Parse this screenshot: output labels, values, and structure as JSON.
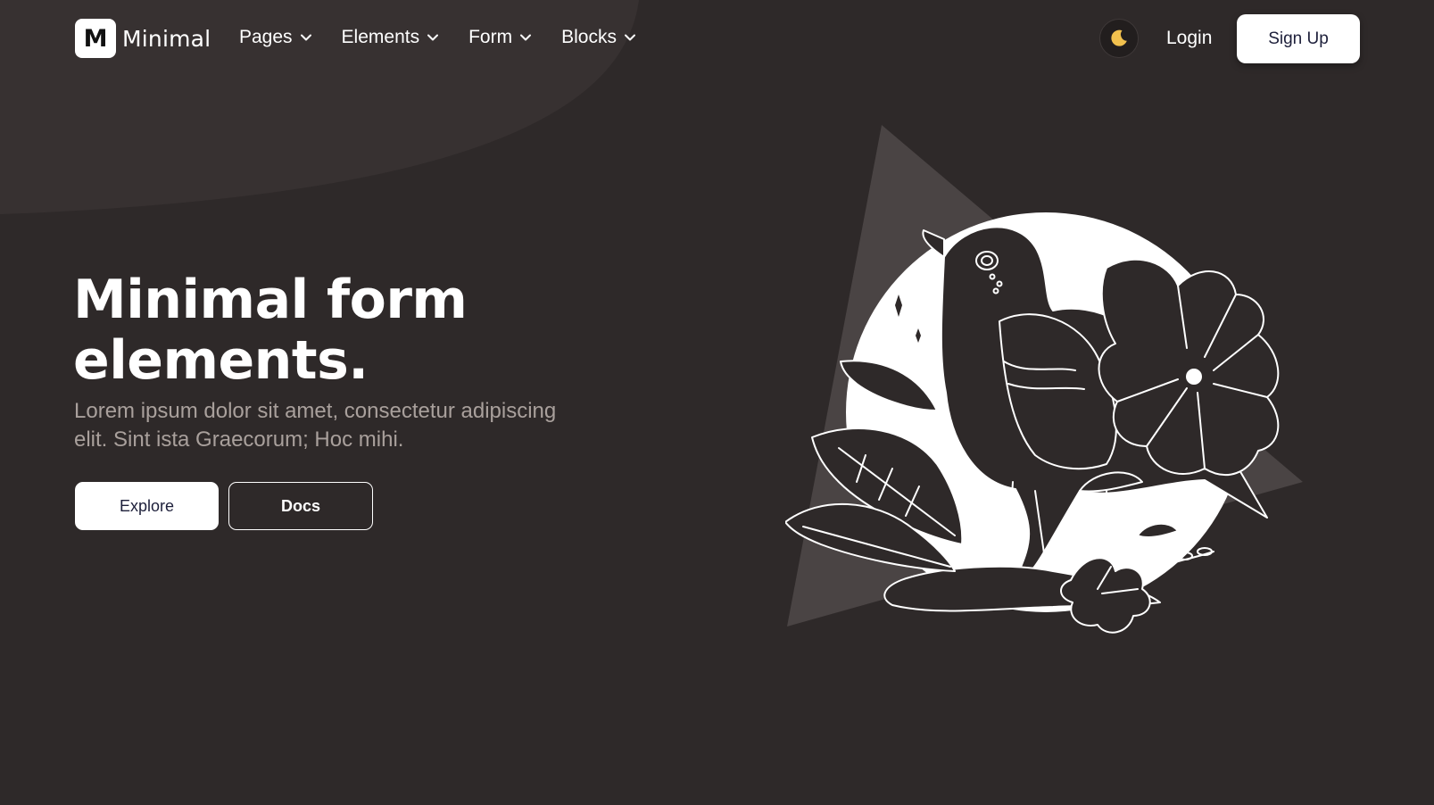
{
  "header": {
    "logo_letter": "M",
    "brand": "Minimal",
    "nav": [
      {
        "label": "Pages"
      },
      {
        "label": "Elements"
      },
      {
        "label": "Form"
      },
      {
        "label": "Blocks"
      }
    ],
    "theme_icon": "moon-icon",
    "login_label": "Login",
    "signup_label": "Sign Up"
  },
  "hero": {
    "title_line1": "Minimal form",
    "title_line2": "elements.",
    "description_line1": "Lorem ipsum dolor sit amet, consectetur adipiscing",
    "description_line2": "elit. Sint ista Graecorum; Hoc mihi.",
    "explore_label": "Explore",
    "docs_label": "Docs"
  },
  "illustration": {
    "icon": "bird-with-flowers-illustration"
  },
  "colors": {
    "background": "#2e2929",
    "blob": "#373131",
    "triangle": "#4a4444",
    "moon": "#f2c14e",
    "primary_text": "#ffffff",
    "muted_text": "#a9a09c",
    "button_text_dark": "#1d1f3a"
  }
}
